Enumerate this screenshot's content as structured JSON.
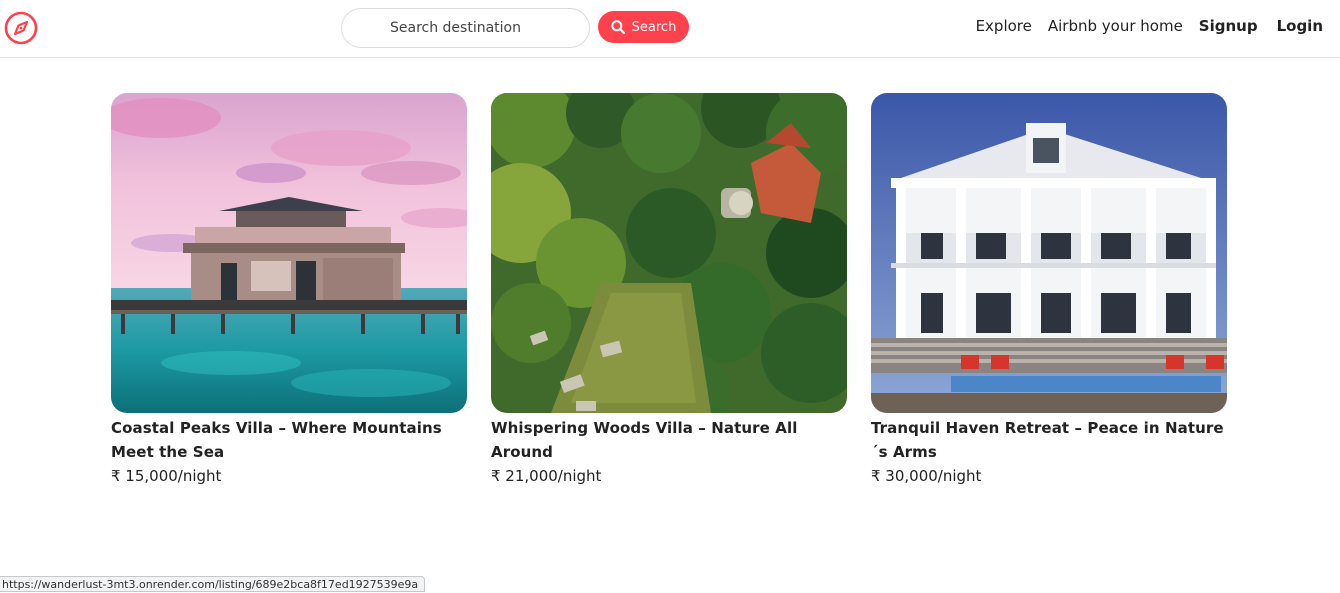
{
  "brand": {
    "logo_icon": "compass-icon",
    "accent_color": "#fe424d"
  },
  "search": {
    "placeholder": "Search destination",
    "button_label": "Search",
    "button_icon": "search-icon"
  },
  "nav": {
    "explore": "Explore",
    "host": "Airbnb your home",
    "signup": "Signup",
    "login": "Login"
  },
  "listings": [
    {
      "title": "Coastal Peaks Villa – Where Mountains Meet the Sea",
      "price": "₹ 15,000/night"
    },
    {
      "title": "Whispering Woods Villa – Nature All Around",
      "price": "₹ 21,000/night"
    },
    {
      "title": "Tranquil Haven Retreat – Peace in Nature´s Arms",
      "price": "₹ 30,000/night"
    }
  ],
  "status_bar": {
    "url": "https://wanderlust-3mt3.onrender.com/listing/689e2bca8f17ed1927539e9a"
  }
}
